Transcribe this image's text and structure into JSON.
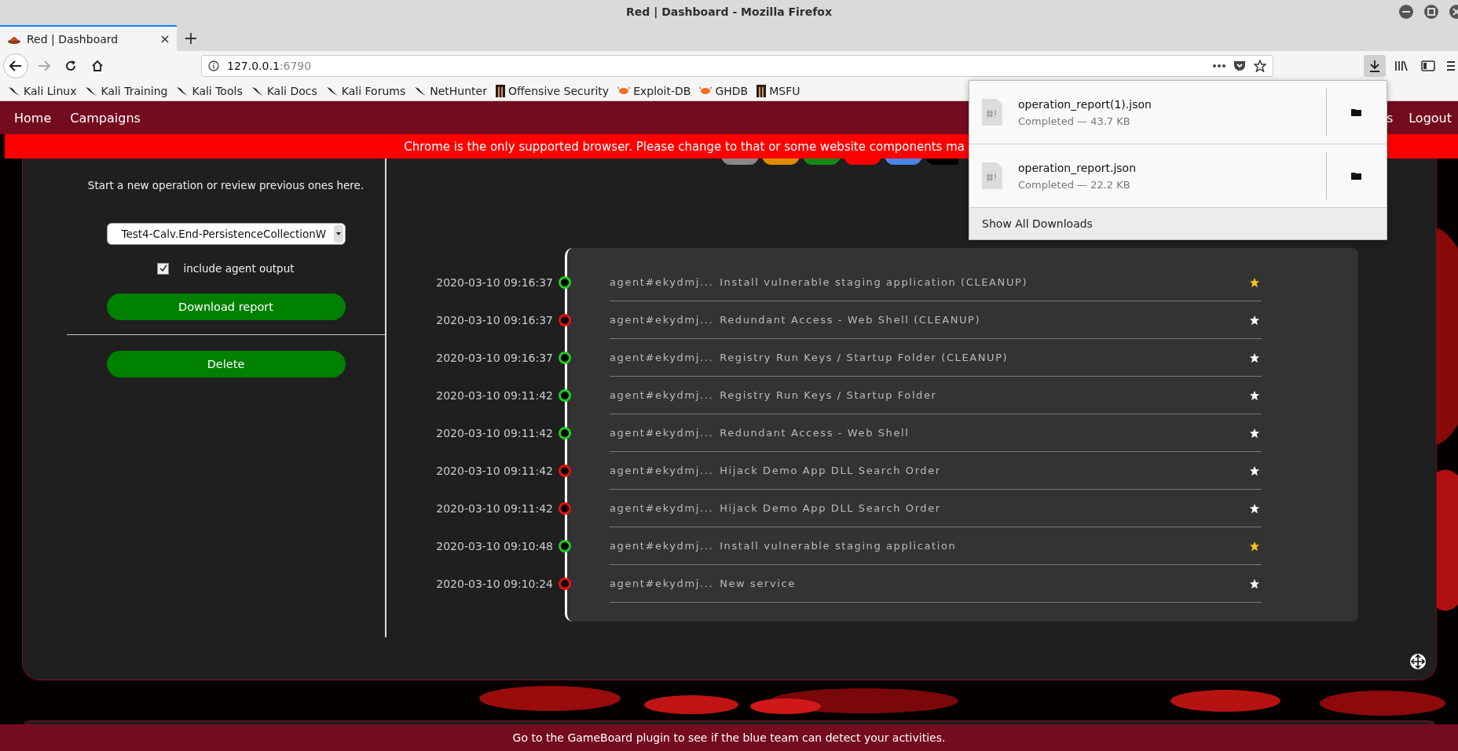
{
  "browser": {
    "window_title": "Red | Dashboard - Mozilla Firefox",
    "tab_title": "Red | Dashboard",
    "url_host": "127.0.0.1",
    "url_port": ":6790",
    "bookmarks": [
      {
        "label": "Kali Linux",
        "kind": "kali"
      },
      {
        "label": "Kali Training",
        "kind": "kali"
      },
      {
        "label": "Kali Tools",
        "kind": "kali"
      },
      {
        "label": "Kali Docs",
        "kind": "kali"
      },
      {
        "label": "Kali Forums",
        "kind": "kali"
      },
      {
        "label": "NetHunter",
        "kind": "kali"
      },
      {
        "label": "Offensive Security",
        "kind": "offsec"
      },
      {
        "label": "Exploit-DB",
        "kind": "exploitdb"
      },
      {
        "label": "GHDB",
        "kind": "exploitdb"
      },
      {
        "label": "MSFU",
        "kind": "offsec"
      }
    ],
    "downloads": {
      "items": [
        {
          "name": "operation_report(1).json",
          "status": "Completed — 43.7 KB"
        },
        {
          "name": "operation_report.json",
          "status": "Completed — 22.2 KB"
        }
      ],
      "footer": "Show All Downloads"
    }
  },
  "nav": {
    "items": [
      "Home",
      "Campaigns"
    ],
    "right_items": [
      "s",
      "Logout"
    ]
  },
  "warning": "Chrome is the only supported browser. Please change to that or some website components ma",
  "left": {
    "intro": "Start a new operation or review previous ones here.",
    "operation_select": "Test4-Calv.End-PersistenceCollectionW",
    "include_agent_output": {
      "label": "include agent output",
      "checked": true
    },
    "buttons": [
      "Download report",
      "Delete"
    ]
  },
  "timeline": [
    {
      "date": "2020-03-10 09:16:37",
      "color": "#22c922",
      "agent": "agent#ekydmj...",
      "name": "Install vulnerable staging application (CLEANUP)",
      "starred": true
    },
    {
      "date": "2020-03-10 09:16:37",
      "color": "#e81010",
      "agent": "agent#ekydmj...",
      "name": "Redundant Access - Web Shell (CLEANUP)",
      "starred": false
    },
    {
      "date": "2020-03-10 09:16:37",
      "color": "#22c922",
      "agent": "agent#ekydmj...",
      "name": "Registry Run Keys / Startup Folder (CLEANUP)",
      "starred": false
    },
    {
      "date": "2020-03-10 09:11:42",
      "color": "#22c922",
      "agent": "agent#ekydmj...",
      "name": "Registry Run Keys / Startup Folder",
      "starred": false
    },
    {
      "date": "2020-03-10 09:11:42",
      "color": "#22c922",
      "agent": "agent#ekydmj...",
      "name": "Redundant Access - Web Shell",
      "starred": false
    },
    {
      "date": "2020-03-10 09:11:42",
      "color": "#e81010",
      "agent": "agent#ekydmj...",
      "name": "Hijack Demo App DLL Search Order",
      "starred": false
    },
    {
      "date": "2020-03-10 09:11:42",
      "color": "#e81010",
      "agent": "agent#ekydmj...",
      "name": "Hijack Demo App DLL Search Order",
      "starred": false
    },
    {
      "date": "2020-03-10 09:10:48",
      "color": "#22c922",
      "agent": "agent#ekydmj...",
      "name": "Install vulnerable staging application",
      "starred": true
    },
    {
      "date": "2020-03-10 09:10:24",
      "color": "#e81010",
      "agent": "agent#ekydmj...",
      "name": "New service",
      "starred": false
    }
  ],
  "footer_banner": "Go to the GameBoard plugin to see if the blue team can detect your activities."
}
